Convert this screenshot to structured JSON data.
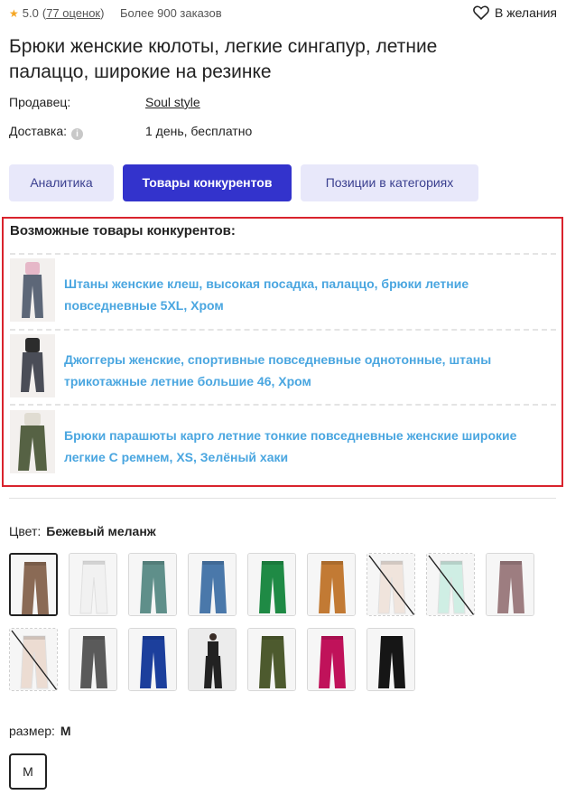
{
  "header": {
    "rating_value": "5.0",
    "reviews_text": "77 оценок",
    "orders_text": "Более 900 заказов",
    "wishlist_label": "В желания"
  },
  "product": {
    "title": "Брюки женские кюлоты, легкие сингапур, летние палаццо, широкие на резинке"
  },
  "info": {
    "seller_label": "Продавец:",
    "seller_value": "Soul style",
    "delivery_label": "Доставка:",
    "delivery_value": "1 день, бесплатно"
  },
  "tabs": [
    {
      "label": "Аналитика"
    },
    {
      "label": "Товары конкурентов"
    },
    {
      "label": "Позиции в категориях"
    }
  ],
  "competitors": {
    "heading": "Возможные товары конкурентов:",
    "items": [
      {
        "text": "Штаны женские клеш, высокая посадка, палаццо, брюки летние повседневные 5XL, Хром",
        "pants_color": "#5d6778",
        "top_color": "#e6b8c8"
      },
      {
        "text": "Джоггеры женские, спортивные повседневные однотонные, штаны трикотажные летние большие 46, Хром",
        "pants_color": "#4a4d57",
        "top_color": "#2c2c2c"
      },
      {
        "text": "Брюки парашюты карго летние тонкие повседневные женские широкие легкие С ремнем, XS, Зелёный хаки",
        "pants_color": "#566244",
        "top_color": "#e0dcd2"
      }
    ]
  },
  "color": {
    "label": "Цвет:",
    "value": "Бежевый меланж",
    "swatches": [
      {
        "color": "#8a6a55",
        "state": "selected"
      },
      {
        "color": "#f1f1f1",
        "state": "normal"
      },
      {
        "color": "#5f8f8a",
        "state": "normal"
      },
      {
        "color": "#4a78aa",
        "state": "normal"
      },
      {
        "color": "#1f8a45",
        "state": "normal"
      },
      {
        "color": "#c27a34",
        "state": "normal"
      },
      {
        "color": "#f0e4dc",
        "state": "unavailable"
      },
      {
        "color": "#cfeee4",
        "state": "unavailable"
      },
      {
        "color": "#9d7d80",
        "state": "normal"
      },
      {
        "color": "#ecdcd2",
        "state": "unavailable"
      },
      {
        "color": "#5a5a5a",
        "state": "normal"
      },
      {
        "color": "#1c3f9c",
        "state": "normal"
      },
      {
        "color": "#222222",
        "state": "model"
      },
      {
        "color": "#4d5a2e",
        "state": "normal"
      },
      {
        "color": "#c0125a",
        "state": "normal"
      },
      {
        "color": "#161616",
        "state": "normal"
      }
    ]
  },
  "size": {
    "label": "размер:",
    "value": "M",
    "options": [
      "M"
    ]
  }
}
